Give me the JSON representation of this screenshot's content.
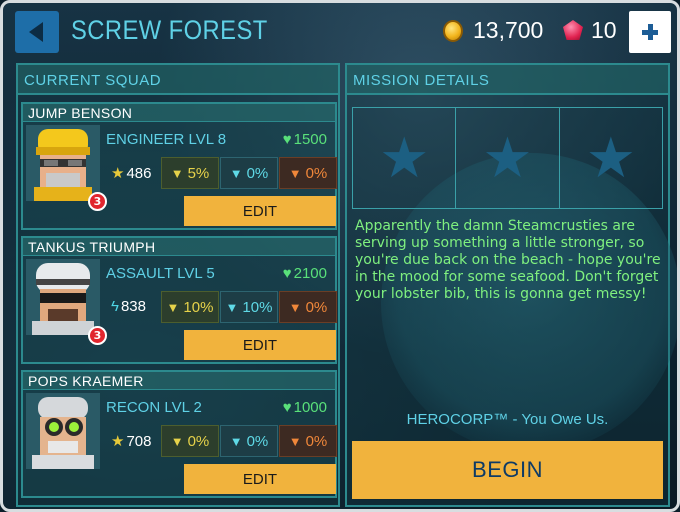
{
  "header": {
    "title": "SCREW FOREST",
    "coins": "13,700",
    "gems": "10"
  },
  "squad": {
    "title": "CURRENT SQUAD",
    "members": [
      {
        "name": "JUMP BENSON",
        "role": "ENGINEER LVL 8",
        "hp": "1500",
        "power": "486",
        "power_icon": "star-icon",
        "badge": "3",
        "stat_yellow": "5%",
        "stat_cyan": "0%",
        "stat_orange": "0%",
        "edit_label": "EDIT"
      },
      {
        "name": "TANKUS TRIUMPH",
        "role": "ASSAULT LVL 5",
        "hp": "2100",
        "power": "838",
        "power_icon": "bolt-icon",
        "badge": "3",
        "stat_yellow": "10%",
        "stat_cyan": "10%",
        "stat_orange": "0%",
        "edit_label": "EDIT"
      },
      {
        "name": "POPS KRAEMER",
        "role": "RECON LVL 2",
        "hp": "1000",
        "power": "708",
        "power_icon": "star-icon",
        "stat_yellow": "0%",
        "stat_cyan": "0%",
        "stat_orange": "0%",
        "edit_label": "EDIT"
      }
    ]
  },
  "mission": {
    "title": "MISSION DETAILS",
    "stars_earned": 0,
    "stars_total": 3,
    "description": "Apparently the damn Steamcrusties are serving up something a little stronger, so you're due back on the beach - hope you're in the mood for some seafood. Don't forget your lobster bib, this is gonna get messy!",
    "tagline": "HEROCORP™ - You Owe Us.",
    "begin_label": "BEGIN"
  },
  "colors": {
    "accent_cyan": "#5fd1e6",
    "button_orange": "#f1b33d",
    "text_green": "#7ff07f",
    "hp_green": "#59e07a",
    "badge_red": "#e1262e"
  }
}
